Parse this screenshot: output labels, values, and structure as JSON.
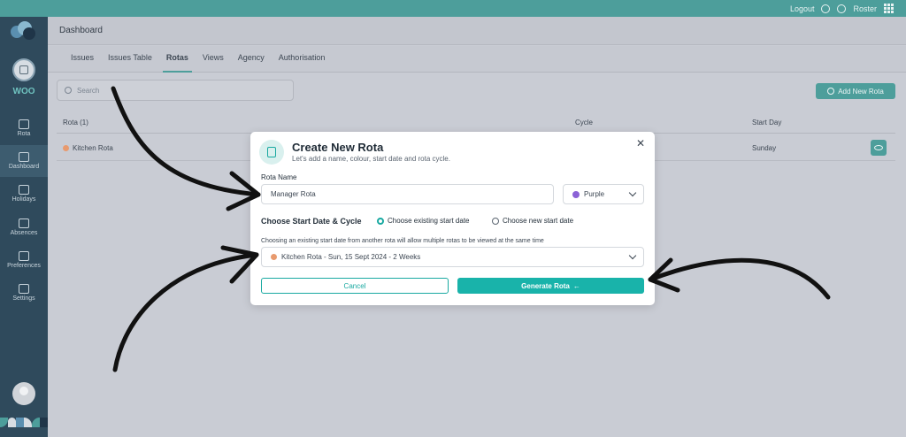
{
  "topbar": {
    "logout_label": "Logout",
    "roster_label": "Roster"
  },
  "header": {
    "title": "Dashboard"
  },
  "sidebar": {
    "org_name": "WOO",
    "items": [
      {
        "label": "Rota",
        "icon": "calendar-icon"
      },
      {
        "label": "Dashboard",
        "icon": "dashboard-icon"
      },
      {
        "label": "Holidays",
        "icon": "holidays-icon"
      },
      {
        "label": "Absences",
        "icon": "absences-icon"
      },
      {
        "label": "Preferences",
        "icon": "preferences-icon"
      },
      {
        "label": "Settings",
        "icon": "gear-icon"
      }
    ]
  },
  "tabs": [
    {
      "label": "Issues"
    },
    {
      "label": "Issues Table"
    },
    {
      "label": "Rotas",
      "active": true
    },
    {
      "label": "Views"
    },
    {
      "label": "Agency"
    },
    {
      "label": "Authorisation"
    }
  ],
  "search": {
    "placeholder": "Search"
  },
  "add_button": {
    "label": "Add New Rota"
  },
  "table": {
    "headers": {
      "rota": "Rota (1)",
      "cycle": "Cycle",
      "start_day": "Start Day"
    },
    "rows": [
      {
        "rota": "Kitchen Rota",
        "cycle": "",
        "start_day": "Sunday"
      }
    ]
  },
  "modal": {
    "title": "Create New Rota",
    "subtitle": "Let's add a name, colour, start date and rota cycle.",
    "rota_name_label": "Rota Name",
    "rota_name_value": "Manager Rota",
    "colour_value": "Purple",
    "cycle_title": "Choose Start Date & Cycle",
    "radio_existing": "Choose existing start date",
    "radio_new": "Choose new start date",
    "hint": "Choosing an existing start date from another rota will allow multiple rotas to be viewed at the same time",
    "existing_rota_value": "Kitchen Rota - Sun, 15 Sept 2024 - 2 Weeks",
    "cancel_label": "Cancel",
    "generate_label": "Generate Rota"
  },
  "colors": {
    "accent": "#19b3aa",
    "sidebar": "#2f4a5c",
    "topbar": "#4d9e9b",
    "purple": "#8b62d6",
    "orange": "#e89a6e"
  }
}
